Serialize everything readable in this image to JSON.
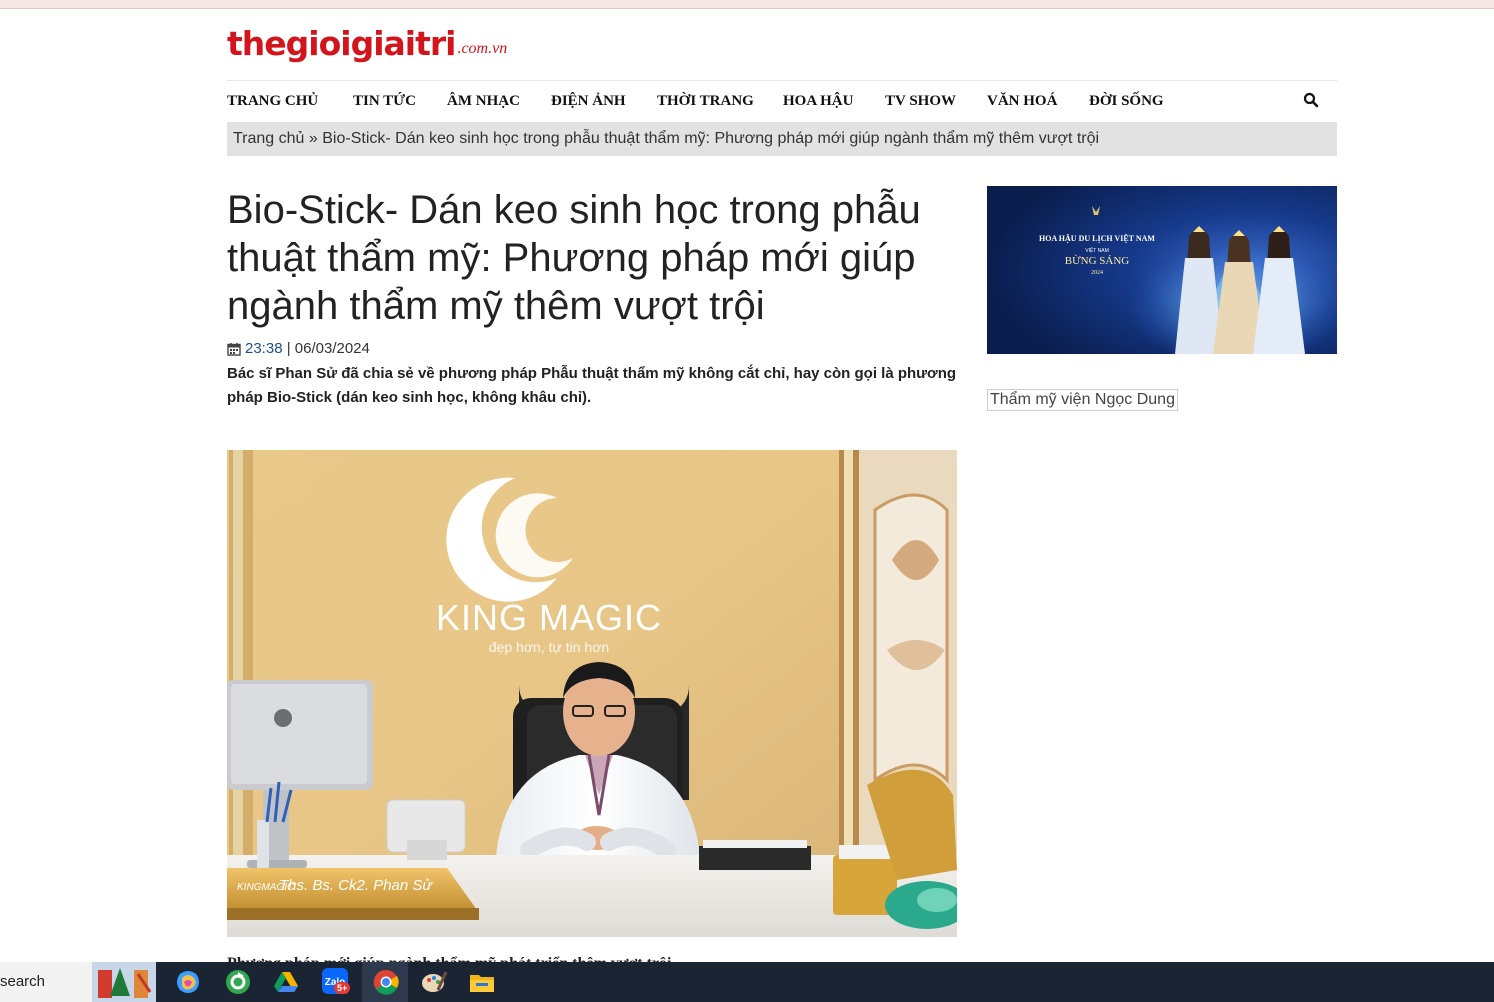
{
  "site": {
    "logo_main": "thegioigiaitri",
    "logo_domain": ".com.vn",
    "colors": {
      "brand": "#d4141c",
      "breadcrumb_bg": "#e2e2e2",
      "link": "#1f4f86"
    }
  },
  "nav": {
    "items": [
      {
        "label": "TRANG CHỦ"
      },
      {
        "label": "TIN TỨC"
      },
      {
        "label": "ÂM NHẠC"
      },
      {
        "label": "ĐIỆN ẢNH"
      },
      {
        "label": "THỜI TRANG"
      },
      {
        "label": "HOA HẬU"
      },
      {
        "label": "TV SHOW"
      },
      {
        "label": "VĂN HOÁ"
      },
      {
        "label": "ĐỜI SỐNG"
      }
    ],
    "search_icon": "search-icon"
  },
  "breadcrumb": {
    "home": "Trang chủ",
    "separator": " » ",
    "current": "Bio-Stick- Dán keo sinh học trong phẫu thuật thẩm mỹ:  Phương pháp mới giúp ngành thẩm mỹ thêm vượt trội"
  },
  "article": {
    "title": "Bio-Stick- Dán keo sinh học trong phẫu thuật thẩm mỹ:  Phương pháp mới giúp ngành thẩm mỹ thêm vượt trội",
    "time": "23:38",
    "date_sep": " | ",
    "date": "06/03/2024",
    "summary": "Bác sĩ Phan Sử đã chia sẻ về phương pháp Phẫu thuật thẩm mỹ không cắt chỉ,  hay còn gọi là phương pháp Bio-Stick (dán keo sinh học, không khâu chỉ).",
    "image": {
      "brand": "KING MAGIC",
      "tagline": "đẹp hơn, tự tin hơn",
      "nameplate": "Ths. Bs. Ck2. Phan Sử",
      "plate_logo": "KINGMAGIC"
    },
    "caption_peek": "Phương pháp mới giúp ngành thẩm mỹ phát triển thêm vượt trội"
  },
  "sidebar": {
    "ad1": {
      "title": "HOA HẬU DU LỊCH VIỆT NAM",
      "sub": "VIỆT NAM",
      "slogan": "BỪNG SÁNG",
      "year": "2024"
    },
    "ad2_alt": "Thẩm mỹ viện Ngọc Dung"
  },
  "taskbar": {
    "search_label": "search",
    "badge": "5+"
  }
}
